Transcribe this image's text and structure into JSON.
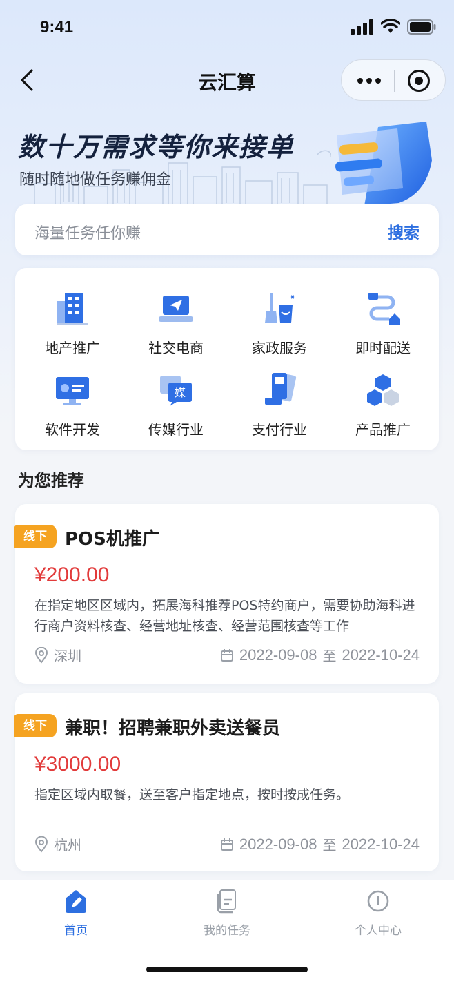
{
  "status_bar": {
    "time": "9:41"
  },
  "nav": {
    "title": "云汇算"
  },
  "banner": {
    "title": "数十万需求等你来接单",
    "subtitle": "随时随地做任务赚佣金"
  },
  "search": {
    "placeholder": "海量任务任你赚",
    "button": "搜索"
  },
  "categories": [
    {
      "label": "地产推广",
      "icon": "building-icon"
    },
    {
      "label": "社交电商",
      "icon": "laptop-send-icon"
    },
    {
      "label": "家政服务",
      "icon": "cleaning-icon"
    },
    {
      "label": "即时配送",
      "icon": "delivery-route-icon"
    },
    {
      "label": "软件开发",
      "icon": "monitor-icon"
    },
    {
      "label": "传媒行业",
      "icon": "media-icon"
    },
    {
      "label": "支付行业",
      "icon": "pos-payment-icon"
    },
    {
      "label": "产品推广",
      "icon": "cubes-icon"
    }
  ],
  "recommend": {
    "title": "为您推荐"
  },
  "tasks": [
    {
      "tag": "线下",
      "title": "POS机推广",
      "price": "¥200.00",
      "description": "在指定地区区域内，拓展海科推荐POS特约商户，需要协助海科进行商户资料核查、经营地址核查、经营范围核查等工作",
      "location": "深圳",
      "date_start": "2022-09-08",
      "date_sep": "至",
      "date_end": "2022-10-24"
    },
    {
      "tag": "线下",
      "title": "兼职！招聘兼职外卖送餐员",
      "price": "¥3000.00",
      "description": "指定区域内取餐，送至客户指定地点，按时按成任务。",
      "location": "杭州",
      "date_start": "2022-09-08",
      "date_sep": "至",
      "date_end": "2022-10-24"
    }
  ],
  "tab_bar": {
    "items": [
      {
        "label": "首页",
        "active": true,
        "icon": "home-pen-icon"
      },
      {
        "label": "我的任务",
        "active": false,
        "icon": "document-icon"
      },
      {
        "label": "个人中心",
        "active": false,
        "icon": "person-icon"
      }
    ],
    "active_color": "#2d6fe0",
    "inactive_color": "#9aa0a8"
  },
  "colors": {
    "accent": "#2d6fe0",
    "price": "#e23b3b",
    "tag": "#f5a321"
  }
}
